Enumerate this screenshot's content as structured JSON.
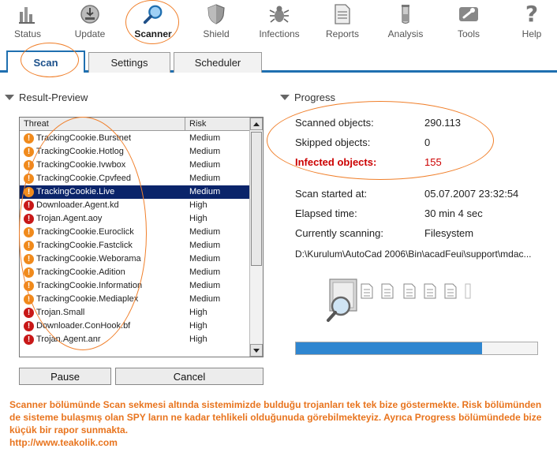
{
  "toolbar": {
    "items": [
      {
        "label": "Status",
        "icon": "status-icon"
      },
      {
        "label": "Update",
        "icon": "update-icon"
      },
      {
        "label": "Scanner",
        "icon": "scanner-icon"
      },
      {
        "label": "Shield",
        "icon": "shield-icon"
      },
      {
        "label": "Infections",
        "icon": "bug-icon"
      },
      {
        "label": "Reports",
        "icon": "report-icon"
      },
      {
        "label": "Analysis",
        "icon": "analysis-icon"
      },
      {
        "label": "Tools",
        "icon": "tools-icon"
      },
      {
        "label": "Help",
        "icon": "help-icon"
      }
    ],
    "active": "Scanner"
  },
  "tabs": [
    {
      "label": "Scan"
    },
    {
      "label": "Settings"
    },
    {
      "label": "Scheduler"
    }
  ],
  "result_preview": {
    "title": "Result-Preview",
    "columns": [
      "Threat",
      "Risk"
    ],
    "rows": [
      {
        "threat": "TrackingCookie.Burstnet",
        "risk": "Medium",
        "level": "medium"
      },
      {
        "threat": "TrackingCookie.Hotlog",
        "risk": "Medium",
        "level": "medium"
      },
      {
        "threat": "TrackingCookie.Ivwbox",
        "risk": "Medium",
        "level": "medium"
      },
      {
        "threat": "TrackingCookie.Cpvfeed",
        "risk": "Medium",
        "level": "medium"
      },
      {
        "threat": "TrackingCookie.Live",
        "risk": "Medium",
        "level": "medium",
        "selected": true
      },
      {
        "threat": "Downloader.Agent.kd",
        "risk": "High",
        "level": "high"
      },
      {
        "threat": "Trojan.Agent.aoy",
        "risk": "High",
        "level": "high"
      },
      {
        "threat": "TrackingCookie.Euroclick",
        "risk": "Medium",
        "level": "medium"
      },
      {
        "threat": "TrackingCookie.Fastclick",
        "risk": "Medium",
        "level": "medium"
      },
      {
        "threat": "TrackingCookie.Weborama",
        "risk": "Medium",
        "level": "medium"
      },
      {
        "threat": "TrackingCookie.Adition",
        "risk": "Medium",
        "level": "medium"
      },
      {
        "threat": "TrackingCookie.Information",
        "risk": "Medium",
        "level": "medium"
      },
      {
        "threat": "TrackingCookie.Mediaplex",
        "risk": "Medium",
        "level": "medium"
      },
      {
        "threat": "Trojan.Small",
        "risk": "High",
        "level": "high"
      },
      {
        "threat": "Downloader.ConHook.bf",
        "risk": "High",
        "level": "high"
      },
      {
        "threat": "Trojan.Agent.anr",
        "risk": "High",
        "level": "high"
      }
    ],
    "pause_label": "Pause",
    "cancel_label": "Cancel"
  },
  "progress": {
    "title": "Progress",
    "scanned_label": "Scanned objects:",
    "scanned_value": "290.113",
    "skipped_label": "Skipped objects:",
    "skipped_value": "0",
    "infected_label": "Infected objects:",
    "infected_value": "155",
    "started_label": "Scan started at:",
    "started_value": "05.07.2007 23:32:54",
    "elapsed_label": "Elapsed time:",
    "elapsed_value": "30 min 4 sec",
    "scanning_label": "Currently scanning:",
    "scanning_value": "Filesystem",
    "current_path": "D:\\Kurulum\\AutoCad 2006\\Bin\\acadFeui\\support\\mdac...",
    "progress_fraction": 0.77
  },
  "caption": {
    "line1": "Scanner bölümünde Scan sekmesi altında sistemimizde bulduğu trojanları tek tek bize göstermekte. Risk bölümünden de sisteme bulaşmış olan SPY ların ne kadar tehlikeli olduğunuda görebilmekteyiz. Ayrıca Progress bölümündede bize küçük bir rapor sunmakta.",
    "url": "http://www.teakolik.com"
  },
  "colors": {
    "accent": "#1f6fb0",
    "annotation": "#f07f2a",
    "infected": "#cc0000",
    "medium_risk": "#f08a1c",
    "high_risk": "#c81818",
    "selection": "#0a246a"
  }
}
